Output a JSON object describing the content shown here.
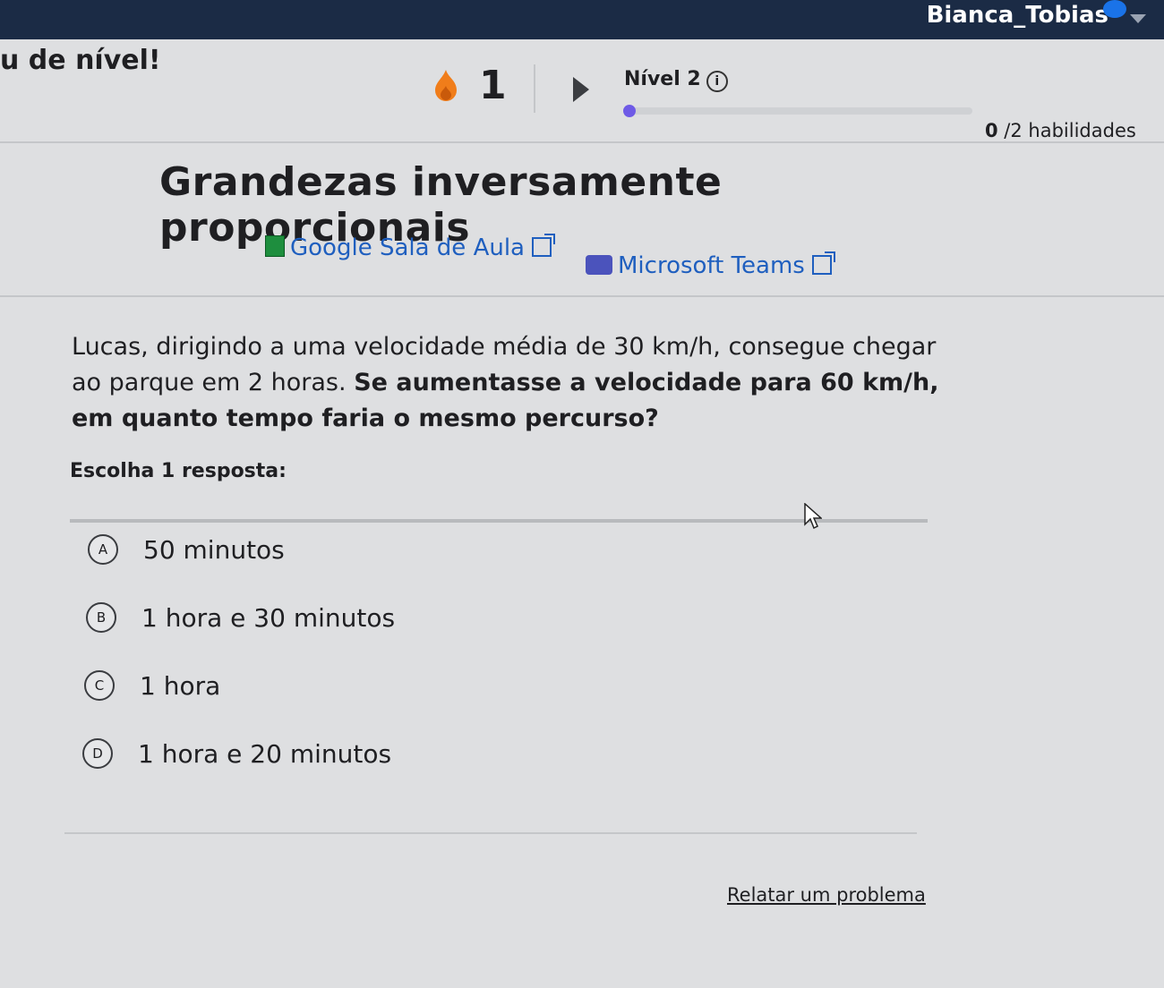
{
  "header": {
    "username": "Bianca_Tobias",
    "level_up_text": "u de nível!",
    "streak_count": "1",
    "level_label": "Nível 2",
    "skills_done": "0",
    "skills_total": " /2 habilidades",
    "progress_fraction": 0
  },
  "exercise": {
    "title": "Grandezas inversamente proporcionais",
    "links": {
      "classroom": "Google Sala de Aula",
      "teams": "Microsoft Teams"
    },
    "question_plain": "Lucas, dirigindo a uma velocidade média de 30 km/h, consegue chegar ao parque em 2 horas.",
    "question_bold": "Se aumentasse a velocidade para 60 km/h, em quanto tempo faria o mesmo percurso?",
    "prompt": "Escolha 1 resposta:",
    "choices": [
      {
        "letter": "A",
        "text": "50 minutos"
      },
      {
        "letter": "B",
        "text": "1 hora e 30 minutos"
      },
      {
        "letter": "C",
        "text": "1 hora"
      },
      {
        "letter": "D",
        "text": "1 hora e 20 minutos"
      }
    ],
    "report_link": "Relatar um problema"
  },
  "colors": {
    "topbar": "#1b2b45",
    "link": "#1f5fbf",
    "progress": "#6e5ae6",
    "streak": "#f07d1a"
  }
}
